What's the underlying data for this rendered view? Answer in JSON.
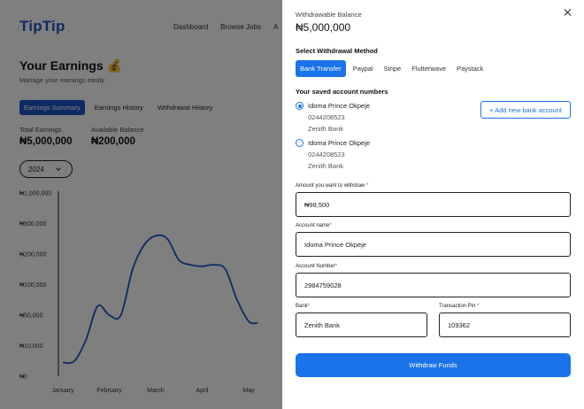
{
  "app": {
    "logo": "TipTip",
    "nav": [
      "Dashboard",
      "Browse Jobs",
      "A"
    ]
  },
  "earnings": {
    "title": "Your Earnings 💰",
    "subtitle": "Manage your earnings easily.",
    "tabs": [
      {
        "label": "Earnings Summary",
        "active": true
      },
      {
        "label": "Earnings History",
        "active": false
      },
      {
        "label": "Withdrawal History",
        "active": false
      }
    ],
    "total_label": "Total Earnings",
    "total_value": "₦5,000,000",
    "available_label": "Available Balance",
    "available_value": "₦200,000",
    "year": "2024"
  },
  "chart_data": {
    "type": "area",
    "title": "",
    "xlabel": "",
    "ylabel": "",
    "y_tick_labels": [
      "₦1,000,000",
      "₦500,000",
      "₦200,000",
      "₦100,000",
      "₦50,000",
      "₦10,000",
      "₦0"
    ],
    "x": [
      "January",
      "February",
      "March",
      "April",
      "May",
      "June"
    ],
    "series_color": "#1a56c4",
    "series": [
      {
        "values": [
          [
            0.0,
            0.45
          ],
          [
            0.25,
            0.5
          ],
          [
            0.5,
            1.2
          ],
          [
            0.75,
            2.3
          ],
          [
            1.0,
            2.0
          ],
          [
            1.25,
            2.0
          ],
          [
            1.5,
            3.5
          ],
          [
            1.75,
            4.3
          ],
          [
            2.0,
            4.6
          ],
          [
            2.25,
            4.5
          ],
          [
            2.5,
            3.8
          ],
          [
            2.75,
            3.65
          ],
          [
            3.0,
            3.6
          ],
          [
            3.25,
            3.65
          ],
          [
            3.5,
            3.5
          ],
          [
            3.75,
            2.5
          ],
          [
            4.0,
            1.8
          ],
          [
            4.2,
            1.75
          ]
        ]
      }
    ]
  },
  "modal": {
    "withdrawable_label": "Withdrawable Balance",
    "withdrawable_value": "₦5,000,000",
    "select_method_label": "Select Withdrawal Method",
    "methods": [
      {
        "label": "Bank Transfer",
        "active": true
      },
      {
        "label": "Paypal",
        "active": false
      },
      {
        "label": "Stripe",
        "active": false
      },
      {
        "label": "Flutterwave",
        "active": false
      },
      {
        "label": "Paystack",
        "active": false
      }
    ],
    "saved_accounts_label": "Your saved account numbers",
    "accounts": [
      {
        "name": "Idoma Prince Okpeje",
        "number": "0244208523",
        "bank": "Zenith Bank",
        "selected": true
      },
      {
        "name": "Idoma Prince Okpeje",
        "number": "0244208523",
        "bank": "Zenith Bank",
        "selected": false
      }
    ],
    "add_bank_label": "+ Add new bank account",
    "amount": {
      "label": "Amount you want to withdraw",
      "value": "₦98,500"
    },
    "account_name": {
      "label": "Account name",
      "value": "Idoma Prince Okpeje"
    },
    "account_number": {
      "label": "Account Number",
      "value": "2984759028"
    },
    "bank": {
      "label": "Bank",
      "value": "Zenith Bank"
    },
    "pin": {
      "label": "Transaction Pin",
      "value": "109362"
    },
    "required_mark": "*",
    "submit_label": "Withdraw Funds"
  }
}
